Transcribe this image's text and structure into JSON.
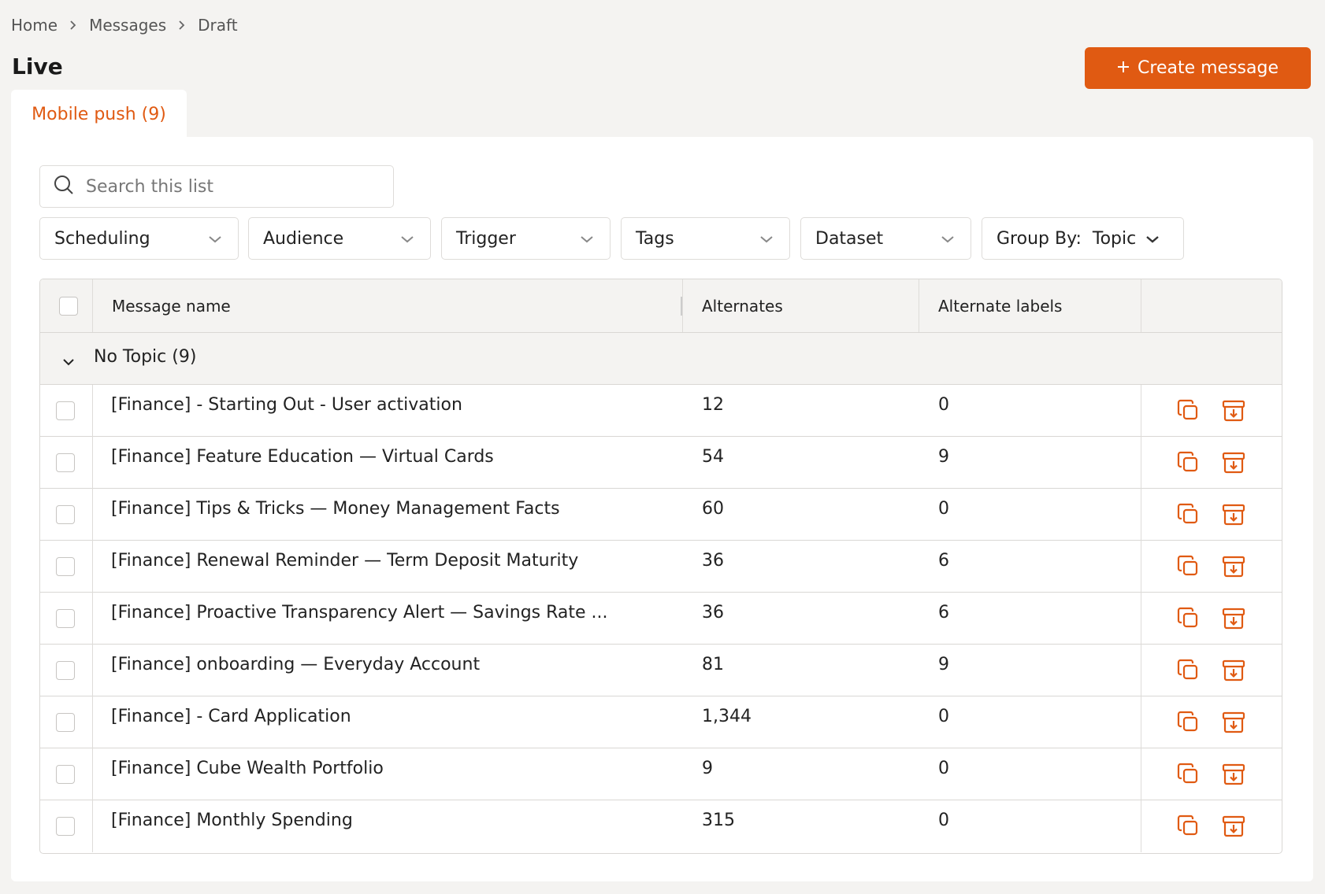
{
  "breadcrumb": [
    "Home",
    "Messages",
    "Draft"
  ],
  "page_title": "Live",
  "create_button": {
    "icon": "plus",
    "label": "Create message"
  },
  "tab": {
    "label": "Mobile push (9)"
  },
  "search": {
    "placeholder": "Search this list",
    "value": ""
  },
  "filters": [
    {
      "label": "Scheduling"
    },
    {
      "label": "Audience"
    },
    {
      "label": "Trigger"
    },
    {
      "label": "Tags"
    },
    {
      "label": "Dataset"
    },
    {
      "label": "Group By:  Topic"
    }
  ],
  "table": {
    "columns": [
      "Message name",
      "Alternates",
      "Alternate labels",
      ""
    ],
    "group": {
      "label": "No Topic (9)",
      "expanded": true
    },
    "rows": [
      {
        "name": "[Finance] - Starting Out - User activation",
        "alternates": "12",
        "labels": "0"
      },
      {
        "name": "[Finance] Feature Education — Virtual Cards",
        "alternates": "54",
        "labels": "9"
      },
      {
        "name": "[Finance] Tips & Tricks — Money Management Facts",
        "alternates": "60",
        "labels": "0"
      },
      {
        "name": "[Finance] Renewal Reminder — Term Deposit Maturity",
        "alternates": "36",
        "labels": "6"
      },
      {
        "name": "[Finance] Proactive Transparency Alert — Savings Rate ...",
        "alternates": "36",
        "labels": "6"
      },
      {
        "name": "[Finance] onboarding — Everyday Account",
        "alternates": "81",
        "labels": "9"
      },
      {
        "name": "[Finance] - Card Application",
        "alternates": "1,344",
        "labels": "0"
      },
      {
        "name": "[Finance] Cube Wealth Portfolio",
        "alternates": "9",
        "labels": "0"
      },
      {
        "name": "[Finance] Monthly Spending",
        "alternates": "315",
        "labels": "0"
      }
    ],
    "row_actions": [
      "duplicate-icon",
      "archive-icon"
    ]
  },
  "colors": {
    "accent": "#e05a12",
    "background": "#f4f3f1",
    "border": "#d9d7d4"
  }
}
